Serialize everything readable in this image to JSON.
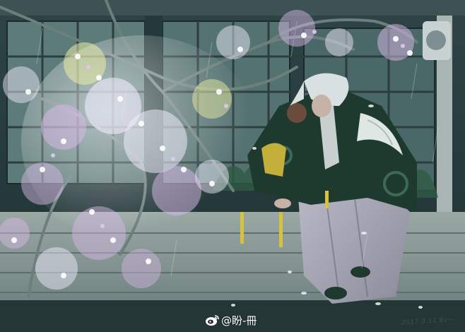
{
  "artwork": {
    "subject": "illustration",
    "palette": {
      "wall": "#24383a",
      "screen": "#4e6d6c",
      "engawa": "#8a9b97",
      "blossom_white": "#f3f0ff",
      "blossom_pink": "#d9b9e8",
      "blossom_yellow": "#eef2a6",
      "haori": "#1e3a2f",
      "hakama": "#a7a6b5",
      "hair": "#d9e0e2"
    }
  },
  "watermark": {
    "icon": "weibo-icon",
    "handle": "@盼-冊"
  },
  "signature": {
    "text": "2017.3.11 By—"
  }
}
